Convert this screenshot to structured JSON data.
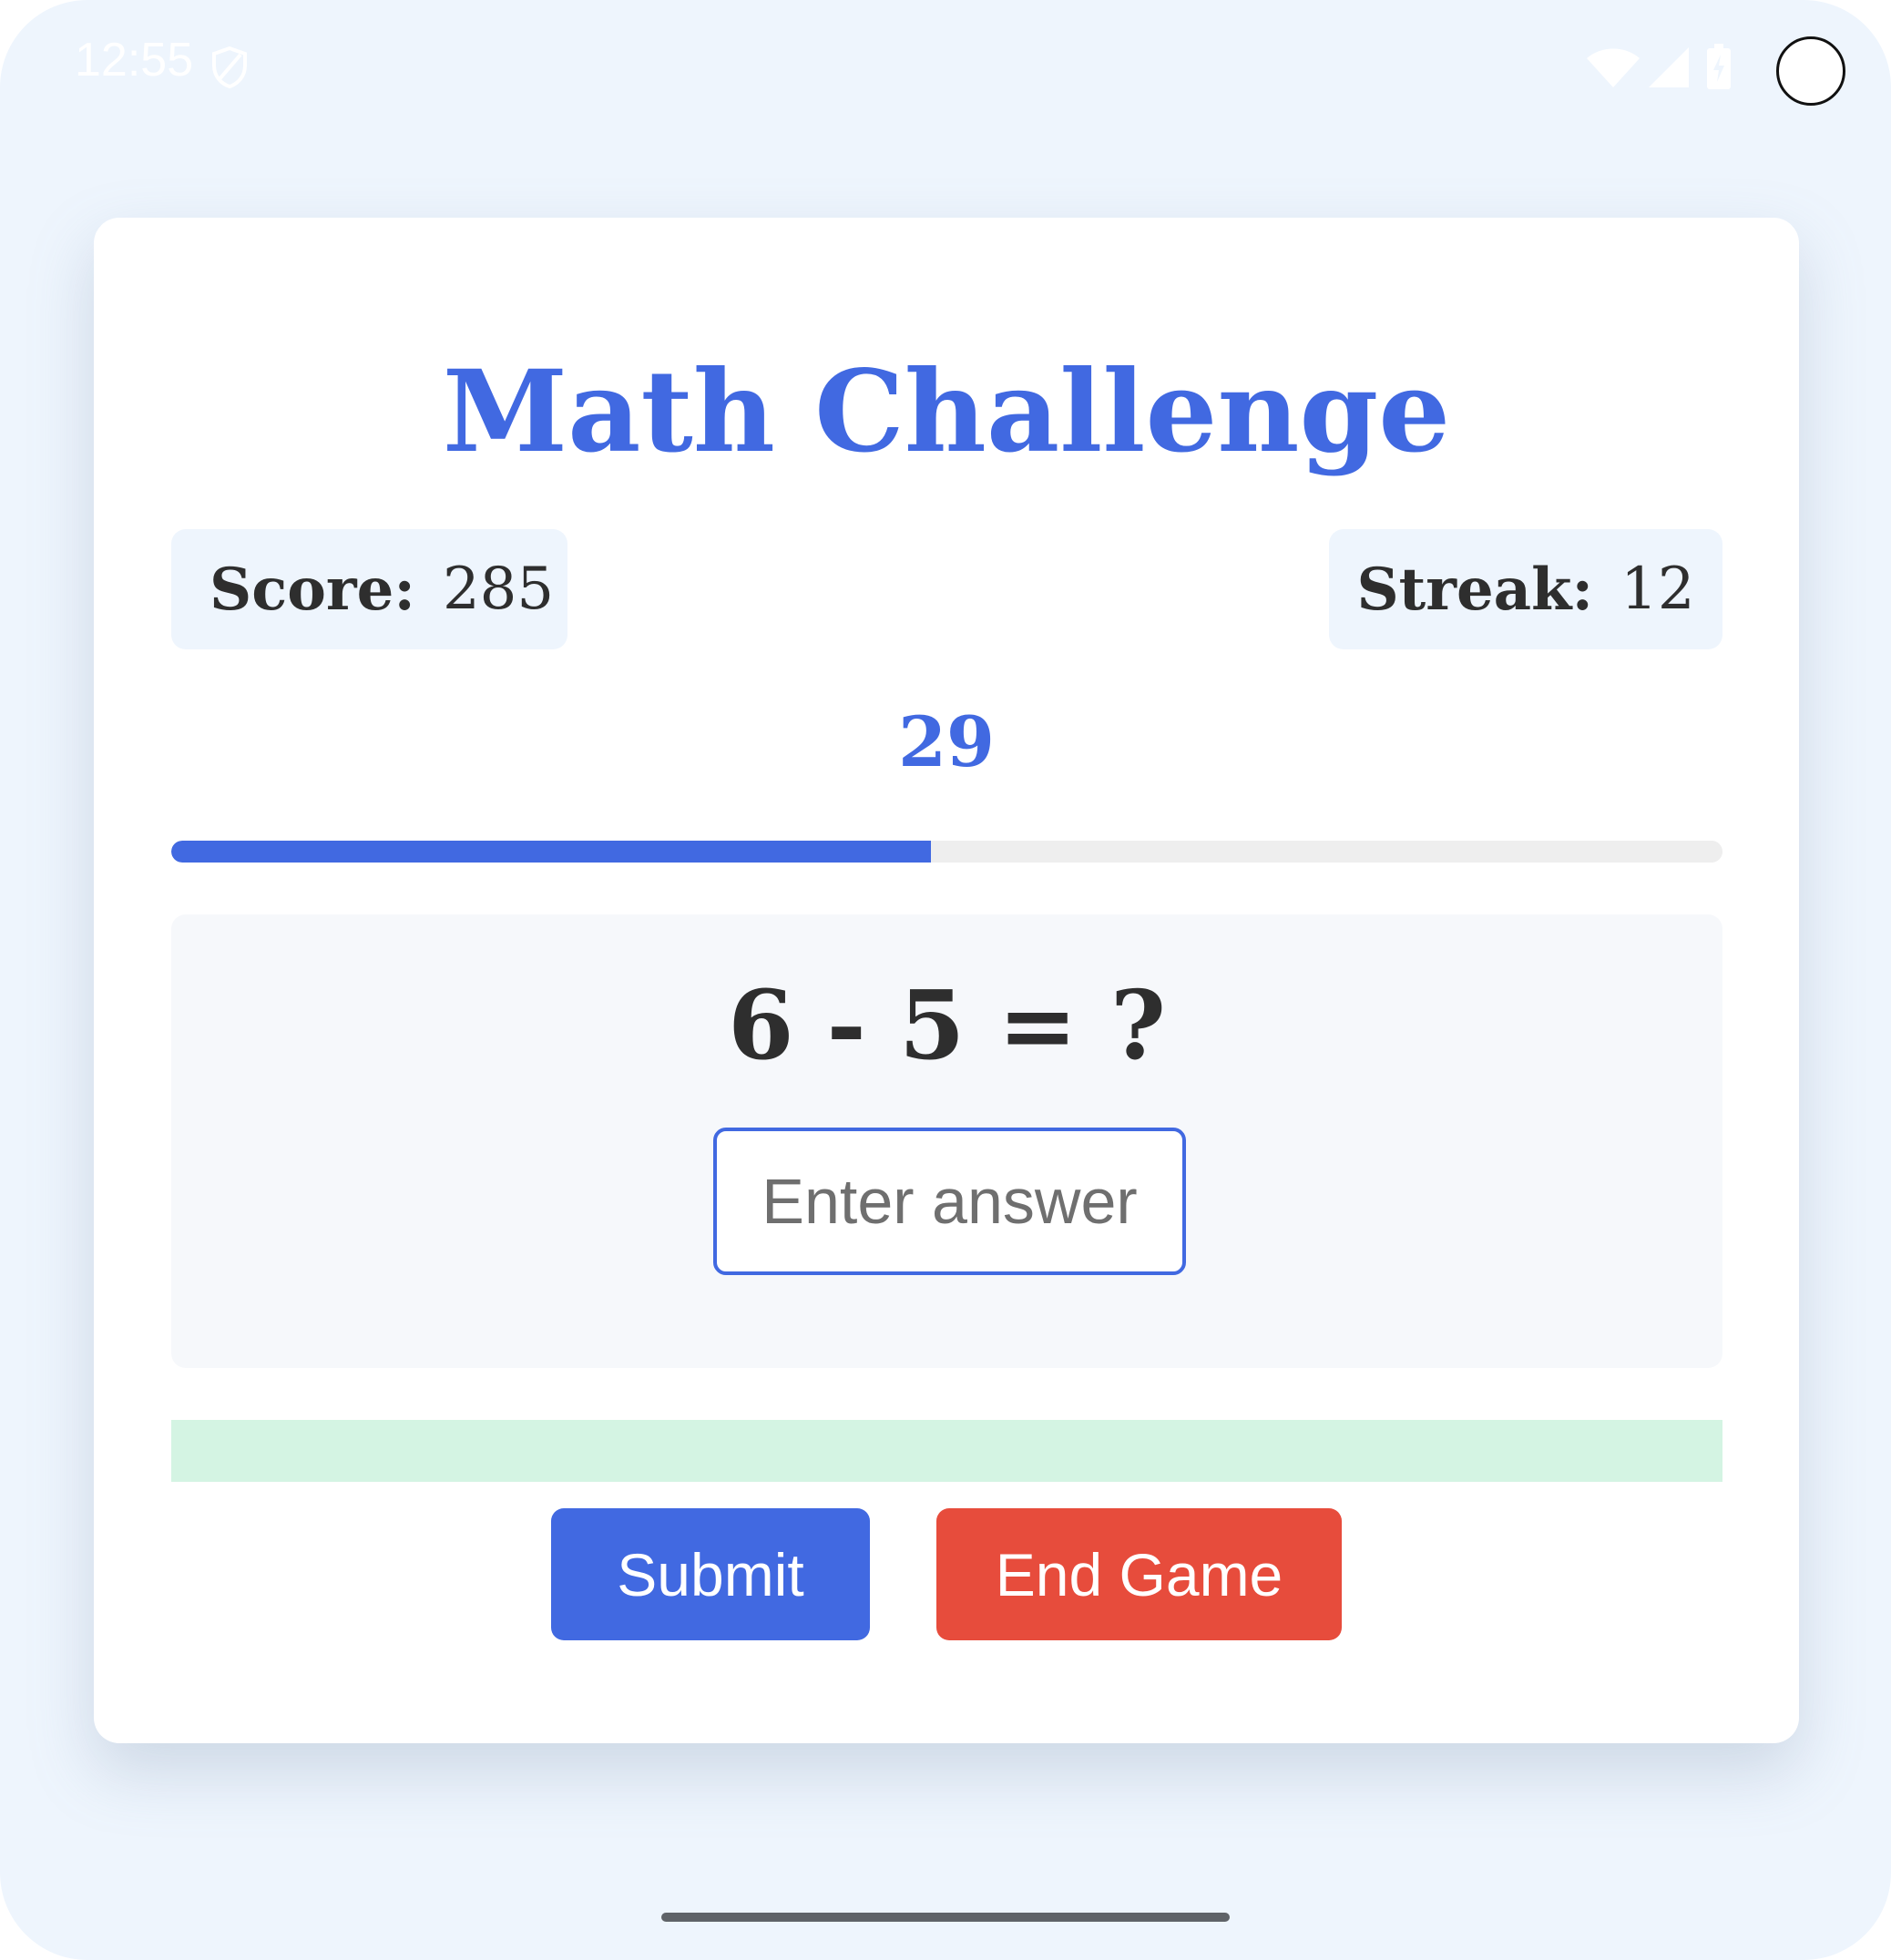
{
  "status_bar": {
    "time": "12:55",
    "icons": [
      "shield-icon",
      "wifi-icon",
      "signal-icon",
      "battery-icon"
    ]
  },
  "game": {
    "title": "Math Challenge",
    "score_label": "Score:",
    "score_value": "285",
    "streak_label": "Streak:",
    "streak_value": "12",
    "timer": "29",
    "progress_fraction": 0.49,
    "question": "6 - 5 = ?",
    "answer_placeholder": "Enter answer",
    "answer_value": "",
    "submit_label": "Submit",
    "end_game_label": "End Game"
  },
  "colors": {
    "accent": "#4169e1",
    "danger": "#e74c3c",
    "feedback_bg": "#d4f4e3",
    "panel_bg": "#f6f8fb",
    "page_bg": "#eef5fd"
  }
}
